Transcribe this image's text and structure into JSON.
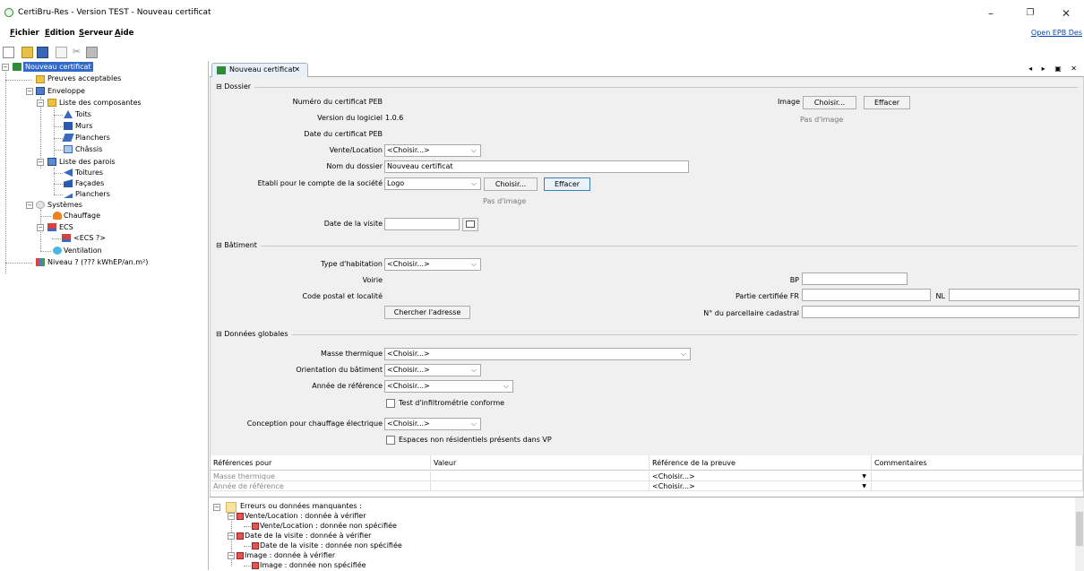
{
  "window": {
    "title": "CertiBru-Res - Version TEST - Nouveau certificat",
    "minimize": "–",
    "maximize": "❐",
    "close": "✕"
  },
  "menu": {
    "items": [
      "Fichier",
      "Edition",
      "Serveur",
      "Aide"
    ],
    "right_link": "Open EPB Des"
  },
  "tree": {
    "root": "Nouveau certificat",
    "preuves": "Preuves acceptables",
    "enveloppe": "Enveloppe",
    "liste_composantes": "Liste des composantes",
    "toits": "Toits",
    "murs": "Murs",
    "planchers": "Planchers",
    "chassis": "Châssis",
    "liste_parois": "Liste des parois",
    "toitures": "Toitures",
    "facades": "Façades",
    "planchers2": "Planchers",
    "systemes": "Systèmes",
    "chauffage": "Chauffage",
    "ecs": "ECS",
    "ecs_child": "<ECS ?>",
    "ventilation": "Ventilation",
    "niveau": "Niveau ? (??? kWhEP/an.m²)"
  },
  "tab": {
    "label": "Nouveau certificat",
    "close": "✕",
    "controls": "◂ ▸ ▣ ✕"
  },
  "dossier": {
    "section": "Dossier",
    "numero_label": "Numéro du certificat PEB",
    "version_label": "Version du logiciel",
    "version_value": "1.0.6",
    "date_cert_label": "Date du certificat PEB",
    "vente_label": "Vente/Location",
    "vente_value": "<Choisir...>",
    "nom_label": "Nom du dossier",
    "nom_value": "Nouveau certificat",
    "etabli_label": "Etabli pour le compte de la société",
    "etabli_value": "Logo",
    "choisir_btn": "Choisir...",
    "effacer_btn": "Effacer",
    "pas_image": "Pas d'image",
    "image_label": "Image",
    "image_choisir": "Choisir...",
    "image_effacer": "Effacer",
    "image_pas": "Pas d'image",
    "date_visite_label": "Date de la visite"
  },
  "batiment": {
    "section": "Bâtiment",
    "type_label": "Type d'habitation",
    "type_value": "<Choisir...>",
    "voirie_label": "Voirie",
    "bp_label": "BP",
    "code_label": "Code postal et localité",
    "partie_label": "Partie certifiée FR",
    "nl_label": "NL",
    "chercher_btn": "Chercher l'adresse",
    "parcellaire_label": "N° du parcellaire cadastral"
  },
  "globales": {
    "section": "Données globales",
    "masse_label": "Masse thermique",
    "masse_value": "<Choisir...>",
    "orientation_label": "Orientation du bâtiment",
    "orientation_value": "<Choisir...>",
    "annee_label": "Année de référence",
    "annee_value": "<Choisir...>",
    "test_label": "Test d'infiltrométrie conforme",
    "conception_label": "Conception pour chauffage électrique",
    "conception_value": "<Choisir...>",
    "espaces_label": "Espaces non résidentiels présents dans VP"
  },
  "references": {
    "headers": [
      "Références pour",
      "Valeur",
      "Référence de la preuve",
      "Commentaires"
    ],
    "rows": [
      {
        "ref": "Masse thermique",
        "valeur": "",
        "preuve": "<Choisir...>",
        "comment": ""
      },
      {
        "ref": "Année de référence",
        "valeur": "",
        "preuve": "<Choisir...>",
        "comment": ""
      }
    ]
  },
  "errors": {
    "root": "Erreurs ou données manquantes :",
    "items": [
      "Vente/Location : donnée à vérifier",
      "Vente/Location : donnée non spécifiée",
      "Date de la visite : donnée à vérifier",
      "Date de la visite : donnée non spécifiée",
      "Image : donnée à vérifier",
      "Image : donnée non spécifiée"
    ]
  }
}
